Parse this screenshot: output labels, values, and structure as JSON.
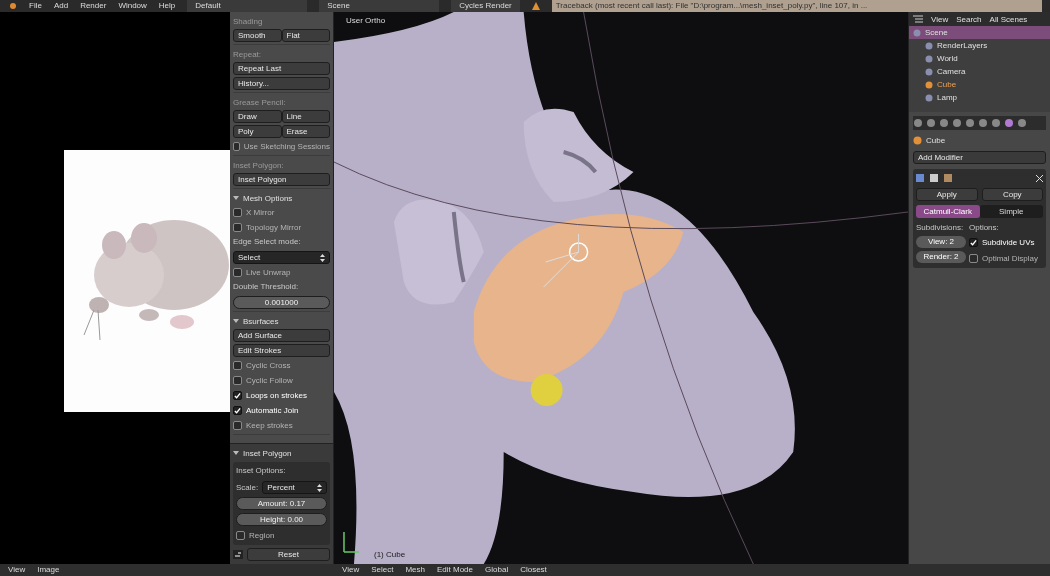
{
  "top_bar": {
    "menus": [
      "File",
      "Add",
      "Render",
      "Window",
      "Help"
    ],
    "layout": "Default",
    "scene": "Scene",
    "engine": "Cycles Render",
    "message": "Traceback (most recent call last): File \"D:\\program...\\mesh_inset_poly.py\", line 107, in ..."
  },
  "tool_panel": {
    "sections": [
      {
        "header": "Shading",
        "collapsible": false,
        "items": [
          {
            "kind": "buttons",
            "labels": [
              "Smooth",
              "Flat"
            ]
          }
        ]
      },
      {
        "header": "Repeat:",
        "collapsible": false,
        "items": [
          {
            "kind": "buttons",
            "labels": [
              "Repeat Last"
            ]
          },
          {
            "kind": "buttons",
            "labels": [
              "History..."
            ]
          }
        ]
      },
      {
        "header": "Grease Pencil:",
        "collapsible": false,
        "items": [
          {
            "kind": "buttons",
            "labels": [
              "Draw",
              "Line"
            ]
          },
          {
            "kind": "buttons",
            "labels": [
              "Poly",
              "Erase"
            ]
          },
          {
            "kind": "checkbox",
            "label": "Use Sketching Sessions",
            "checked": false,
            "disabled": true
          }
        ]
      },
      {
        "header": "Inset Polygon:",
        "collapsible": false,
        "items": [
          {
            "kind": "buttons",
            "labels": [
              "Inset Polygon"
            ]
          }
        ]
      },
      {
        "header": "Mesh Options",
        "collapsible": true,
        "expanded": true,
        "items": [
          {
            "kind": "checkbox",
            "label": "X Mirror",
            "checked": false,
            "disabled": true
          },
          {
            "kind": "checkbox",
            "label": "Topology Mirror",
            "checked": false,
            "disabled": true
          },
          {
            "kind": "label",
            "label": "Edge Select mode:"
          },
          {
            "kind": "select",
            "label": "Select"
          },
          {
            "kind": "checkbox",
            "label": "Live Unwrap",
            "checked": false,
            "disabled": true
          },
          {
            "kind": "label",
            "label": "Double Threshold:"
          },
          {
            "kind": "number",
            "label": "0.001000"
          }
        ]
      },
      {
        "header": "Bsurfaces",
        "collapsible": true,
        "expanded": true,
        "items": [
          {
            "kind": "buttons",
            "labels": [
              "Add Surface"
            ]
          },
          {
            "kind": "buttons",
            "labels": [
              "Edit Strokes"
            ]
          },
          {
            "kind": "checkbox",
            "label": "Cyclic Cross",
            "checked": false,
            "disabled": true
          },
          {
            "kind": "checkbox",
            "label": "Cyclic Follow",
            "checked": false,
            "disabled": true
          },
          {
            "kind": "checkbox",
            "label": "Loops on strokes",
            "checked": true,
            "disabled": false
          },
          {
            "kind": "checkbox",
            "label": "Automatic Join",
            "checked": true,
            "disabled": false
          },
          {
            "kind": "checkbox",
            "label": "Keep strokes",
            "checked": false,
            "disabled": true
          }
        ]
      }
    ]
  },
  "operator_panel": {
    "header": "Inset Polygon",
    "expanded": true,
    "items": [
      {
        "kind": "label",
        "label": "Inset Options:"
      },
      {
        "kind": "select",
        "caption": "Scale:",
        "label": "Percent"
      },
      {
        "kind": "number",
        "label": "Amount: 0.17"
      },
      {
        "kind": "number",
        "label": "Height: 0.00"
      },
      {
        "kind": "checkbox",
        "label": "Region",
        "checked": false,
        "disabled": true
      }
    ],
    "reset": "Reset"
  },
  "viewport": {
    "title": "User Ortho",
    "object": "(1) Cube"
  },
  "outliner": {
    "header": [
      "View",
      "Search",
      "All Scenes"
    ],
    "tree": [
      {
        "label": "Scene",
        "selected": true,
        "active": false,
        "children": [
          {
            "label": "RenderLayers",
            "selected": false,
            "active": false
          },
          {
            "label": "World",
            "selected": false,
            "active": false
          },
          {
            "label": "Camera",
            "selected": false,
            "active": false
          },
          {
            "label": "Cube",
            "selected": false,
            "active": true
          },
          {
            "label": "Lamp",
            "selected": false,
            "active": false
          }
        ]
      }
    ]
  },
  "properties": {
    "object": "Cube",
    "add_modifier": "Add Modifier",
    "actions": [
      "Apply",
      "Copy"
    ],
    "tabs": [
      {
        "label": "Catmull-Clark",
        "selected": true
      },
      {
        "label": "Simple",
        "selected": false
      }
    ],
    "left_label": "Subdivisions:",
    "fields": [
      "View: 2",
      "Render: 2"
    ],
    "right_label": "Options:",
    "options": [
      {
        "label": "Subdivide UVs",
        "checked": true,
        "disabled": false
      },
      {
        "label": "Optimal Display",
        "checked": false,
        "disabled": true
      }
    ]
  },
  "bottom_bar": {
    "left": [
      "View",
      "Image"
    ],
    "right": [
      "View",
      "Select",
      "Mesh",
      "Edit Mode",
      "Global",
      "Closest"
    ]
  }
}
